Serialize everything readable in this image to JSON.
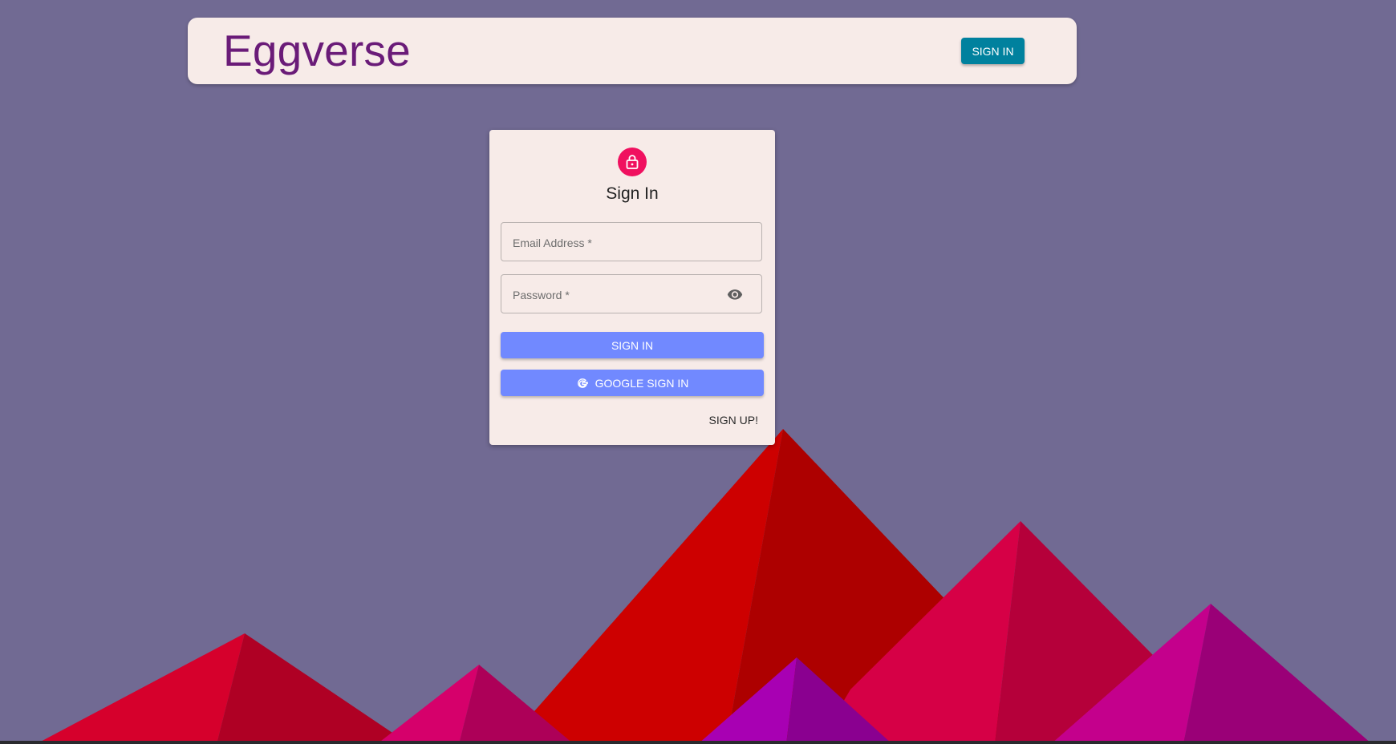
{
  "header": {
    "brand": "Eggverse",
    "signin_label": "SIGN IN",
    "signin_color": "#00819e",
    "brand_color": "#6a1b78"
  },
  "card": {
    "title": "Sign In",
    "icon": "lock-icon",
    "icon_color": "#f0105f",
    "email": {
      "placeholder": "Email Address *",
      "value": ""
    },
    "password": {
      "placeholder": "Password *",
      "value": "",
      "toggle_icon": "eye-icon"
    },
    "signin_label": "SIGN IN",
    "google_label": "GOOGLE SIGN IN",
    "google_icon": "google-g-icon",
    "signup_label": "SIGN UP!",
    "button_color": "#7189ff"
  },
  "theme": {
    "background": "#716a93",
    "surface": "#f7ebe8"
  }
}
